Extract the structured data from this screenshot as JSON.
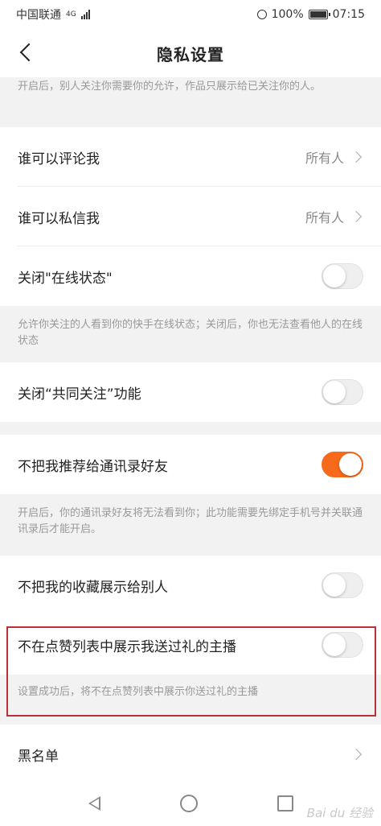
{
  "status_bar": {
    "carrier": "中国联通",
    "network": "4G",
    "battery": "100%",
    "time": "07:15"
  },
  "nav": {
    "title": "隐私设置"
  },
  "top_note": "开启后，别人关注你需要你的允许，作品只展示给已关注你的人。",
  "rows": {
    "comment": {
      "label": "谁可以评论我",
      "value": "所有人"
    },
    "message": {
      "label": "谁可以私信我",
      "value": "所有人"
    },
    "online_status": {
      "label": "关闭\"在线状态\"",
      "on": false
    },
    "online_status_note": "允许你关注的人看到你的快手在线状态；关闭后，你也无法查看他人的在线状态",
    "mutual_follow": {
      "label": "关闭“共同关注”功能",
      "on": false
    },
    "recommend_contacts": {
      "label": "不把我推荐给通讯录好友",
      "on": true
    },
    "recommend_note": "开启后，你的通讯录好友将无法看到你；此功能需要先绑定手机号并关联通讯录后才能开启。",
    "favorites": {
      "label": "不把我的收藏展示给别人",
      "on": false
    },
    "gift_anchor": {
      "label": "不在点赞列表中展示我送过礼的主播",
      "on": false
    },
    "gift_note": "设置成功后，将不在点赞列表中展示你送过礼的主播",
    "blacklist": {
      "label": "黑名单"
    }
  },
  "colors": {
    "accent": "#f76a1b",
    "highlight": "#b8303a"
  },
  "watermark": "Bai du 经验"
}
